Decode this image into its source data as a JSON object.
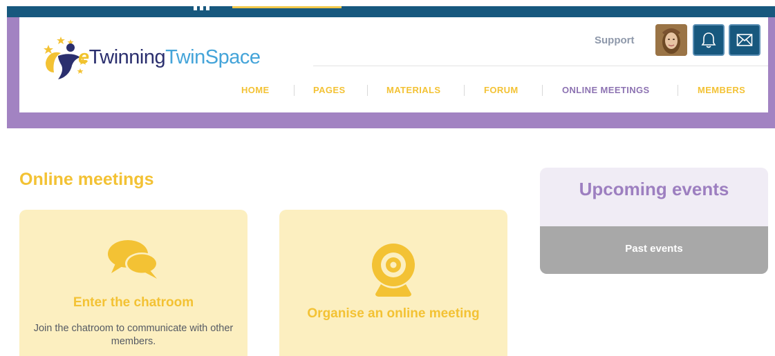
{
  "app": {
    "logo": {
      "prefix": "e",
      "brand": "Twinning",
      "product": "TwinSpace",
      "icon": "etwinning-logo-icon"
    }
  },
  "header": {
    "support_label": "Support",
    "notifications_icon": "bell-icon",
    "messages_icon": "envelope-icon"
  },
  "nav": {
    "items": [
      {
        "label": "HOME"
      },
      {
        "label": "PAGES"
      },
      {
        "label": "MATERIALS"
      },
      {
        "label": "FORUM"
      },
      {
        "label": "ONLINE MEETINGS",
        "active": true
      },
      {
        "label": "MEMBERS"
      }
    ]
  },
  "main": {
    "title": "Online meetings",
    "cards": [
      {
        "icon": "chat-bubbles-icon",
        "title": "Enter the chatroom",
        "description": "Join the chatroom to communicate with other members."
      },
      {
        "icon": "webcam-icon",
        "title": "Organise an online meeting"
      }
    ]
  },
  "sidebar": {
    "upcoming_label": "Upcoming events",
    "past_label": "Past events"
  },
  "colors": {
    "accent_yellow": "#f3c234",
    "purple": "#a283c2",
    "dark_blue": "#17587e",
    "card_bg": "#fcefc0"
  }
}
